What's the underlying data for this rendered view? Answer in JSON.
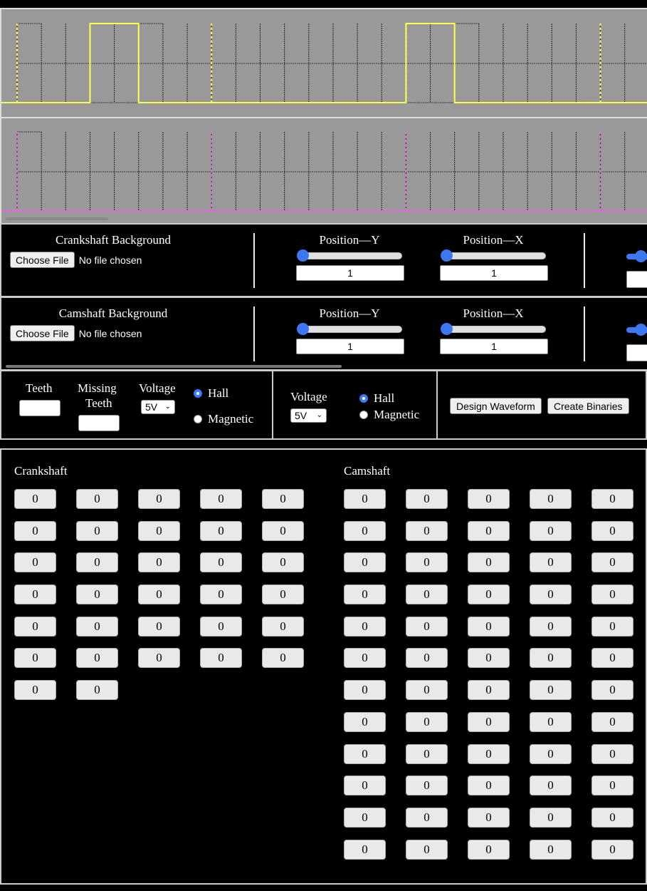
{
  "waveforms": {
    "crankshaft": {
      "color": "#ffff4d",
      "grid_divisions": 26,
      "marker_divisions": [
        0,
        8,
        16,
        24
      ],
      "high_intervals": [
        [
          3,
          5
        ],
        [
          16,
          18
        ]
      ]
    },
    "camshaft": {
      "color": "#e066e0",
      "grid_divisions": 26,
      "marker_divisions": [
        0,
        8,
        16,
        24
      ],
      "high_intervals": []
    }
  },
  "crankshaft_background": {
    "title": "Crankshaft Background",
    "choose_file_label": "Choose File",
    "file_status": "No file chosen",
    "position_y_label": "Position—Y",
    "position_y_value": "1",
    "position_x_label": "Position—X",
    "position_x_value": "1"
  },
  "camshaft_background": {
    "title": "Camshaft Background",
    "choose_file_label": "Choose File",
    "file_status": "No file chosen",
    "position_y_label": "Position—Y",
    "position_y_value": "1",
    "position_x_label": "Position—X",
    "position_x_value": "1"
  },
  "crank_settings": {
    "teeth_label": "Teeth",
    "teeth_value": "",
    "missing_teeth_label_1": "Missing",
    "missing_teeth_label_2": "Teeth",
    "missing_teeth_value": "",
    "voltage_label": "Voltage",
    "voltage_selected": "5V",
    "sensor_options": [
      "Hall",
      "Magnetic"
    ],
    "sensor_selected": "Hall"
  },
  "cam_settings": {
    "voltage_label": "Voltage",
    "voltage_selected": "5V",
    "sensor_options": [
      "Hall",
      "Magnetic"
    ],
    "sensor_selected": "Hall"
  },
  "actions": {
    "design_waveform": "Design Waveform",
    "create_binaries": "Create Binaries"
  },
  "binaries": {
    "crankshaft_title": "Crankshaft",
    "crankshaft_values": [
      "0",
      "0",
      "0",
      "0",
      "0",
      "0",
      "0",
      "0",
      "0",
      "0",
      "0",
      "0",
      "0",
      "0",
      "0",
      "0",
      "0",
      "0",
      "0",
      "0",
      "0",
      "0",
      "0",
      "0",
      "0",
      "0",
      "0",
      "0",
      "0",
      "0",
      "0",
      "0"
    ],
    "camshaft_title": "Camshaft",
    "camshaft_values": [
      "0",
      "0",
      "0",
      "0",
      "0",
      "0",
      "0",
      "0",
      "0",
      "0",
      "0",
      "0",
      "0",
      "0",
      "0",
      "0",
      "0",
      "0",
      "0",
      "0",
      "0",
      "0",
      "0",
      "0",
      "0",
      "0",
      "0",
      "0",
      "0",
      "0",
      "0",
      "0",
      "0",
      "0",
      "0",
      "0",
      "0",
      "0",
      "0",
      "0",
      "0",
      "0",
      "0",
      "0",
      "0",
      "0",
      "0",
      "0",
      "0",
      "0",
      "0",
      "0",
      "0",
      "0",
      "0",
      "0",
      "0",
      "0",
      "0",
      "0"
    ]
  }
}
